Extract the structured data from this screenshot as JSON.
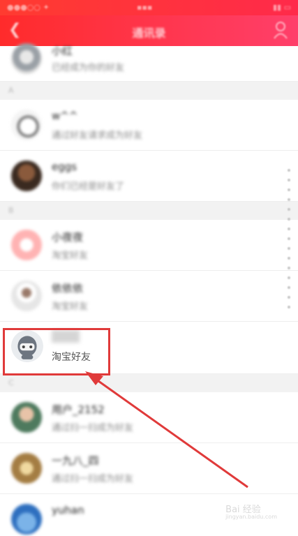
{
  "nav": {
    "title": "通讯录"
  },
  "sections": [
    "A",
    "B",
    "C"
  ],
  "contacts": [
    {
      "name": "小红",
      "sub": "已经成为你的好友"
    },
    {
      "name": "w^^",
      "sub": "通过好友请求成为好友"
    },
    {
      "name": "eggs",
      "sub": "你们已经是好友了"
    },
    {
      "name": "小夜夜",
      "sub": "淘宝好友"
    },
    {
      "name": "依依依",
      "sub": "淘宝好友"
    },
    {
      "name": "",
      "sub": "淘宝好友"
    },
    {
      "name": "用户_2152",
      "sub": "通过扫一扫成为好友"
    },
    {
      "name": "一九八_四",
      "sub": "通过扫一扫成为好友"
    },
    {
      "name": "yuhan",
      "sub": ""
    }
  ],
  "watermark": {
    "line1": "Bai 经验",
    "line2": "jingyan.baidu.com"
  },
  "colors": {
    "nav": "#ff2b2b",
    "highlight": "#e03a3a"
  }
}
